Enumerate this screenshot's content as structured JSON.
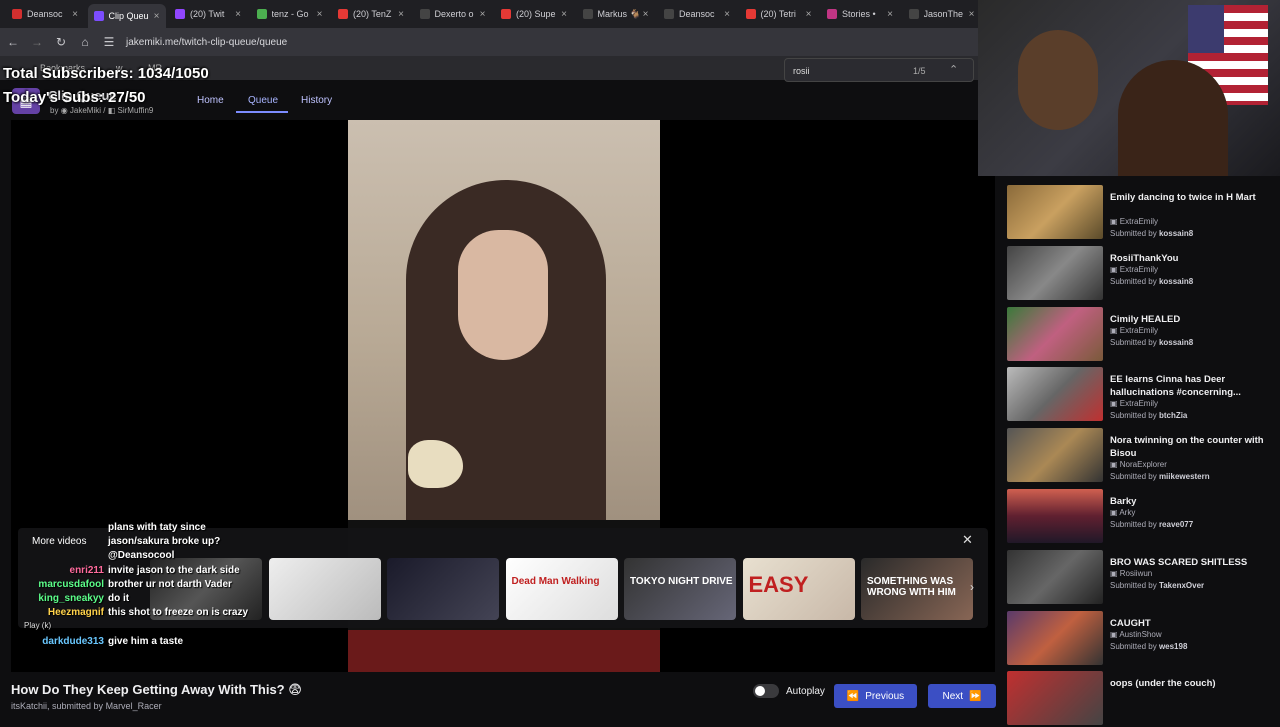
{
  "browser": {
    "tabs": [
      {
        "label": "Deansoc",
        "color": "#d32f2f"
      },
      {
        "label": "Clip Queu",
        "color": "#7c4dff",
        "active": true
      },
      {
        "label": "(20) Twit",
        "color": "#9146ff"
      },
      {
        "label": "tenz - Go",
        "color": "#4caf50"
      },
      {
        "label": "(20) TenZ",
        "color": "#e53935"
      },
      {
        "label": "Dexerto o",
        "color": "#444"
      },
      {
        "label": "(20) Supe",
        "color": "#e53935"
      },
      {
        "label": "Markus 🐐",
        "color": "#444"
      },
      {
        "label": "Deansoc",
        "color": "#444"
      },
      {
        "label": "(20) Tetri",
        "color": "#e53935"
      },
      {
        "label": "Stories •",
        "color": "#c13584"
      },
      {
        "label": "JasonThe",
        "color": "#444"
      }
    ],
    "url": "jakemiki.me/twitch-clip-queue/queue",
    "bookmarks": [
      "Bookmarks",
      "w",
      "MR"
    ],
    "find": {
      "query": "rosii",
      "count": "1/5"
    }
  },
  "overlay": {
    "total_subs": "Total Subscribers: 1034/1050",
    "todays_subs": "Today's Subs: 27/50"
  },
  "site": {
    "title": "Clip Queue",
    "by_prefix": "by",
    "author1": "JakeMiki",
    "author2": "SirMuffin9",
    "nav": {
      "home": "Home",
      "queue": "Queue",
      "history": "History"
    }
  },
  "more_videos": {
    "title": "More videos",
    "thumbs": [
      {
        "text": "",
        "bg": "linear-gradient(135deg,#222,#555,#222)"
      },
      {
        "text": "",
        "bg": "linear-gradient(135deg,#eee,#bbb)"
      },
      {
        "text": "",
        "bg": "linear-gradient(135deg,#1a1a2a,#445)"
      },
      {
        "text": "Dead Man Walking",
        "bg": "linear-gradient(135deg,#fff,#ddd)"
      },
      {
        "text": "TOKYO NIGHT DRIVE",
        "bg": "linear-gradient(135deg,#333,#667)"
      },
      {
        "text": "EASY",
        "bg": "linear-gradient(135deg,#e8e0d0,#c8b8a8)"
      },
      {
        "text": "SOMETHING WAS WRONG WITH HIM",
        "bg": "linear-gradient(135deg,#2a2a2a,#886655)"
      }
    ]
  },
  "chat": [
    {
      "user": "",
      "msg": "plans with taty since",
      "color": "#fff"
    },
    {
      "user": "",
      "msg": "jason/sakura broke up?",
      "color": "#fff"
    },
    {
      "user": "",
      "msg": "@Deansocool",
      "color": "#fff"
    },
    {
      "user": "enri211",
      "msg": "invite jason to the dark side",
      "color": "#ff6b9d"
    },
    {
      "user": "marcusdafool",
      "msg": "brother ur not darth Vader",
      "color": "#5cff8a"
    },
    {
      "user": "king_sneakyy",
      "msg": "do it",
      "color": "#5cff8a"
    },
    {
      "user": "Heezmagnif",
      "msg": "this shot to freeze on is crazy",
      "color": "#ffd24a"
    },
    {
      "user": "Play (k)",
      "msg": "",
      "color": "#ddd"
    },
    {
      "user": "darkdude313",
      "msg": "give him a taste",
      "color": "#6ac8ff"
    }
  ],
  "clip": {
    "title": "How Do They Keep Getting Away With This? 😨",
    "channel": "itsKatchii",
    "submitted_prefix": ", submitted by",
    "submitter": "Marvel_Racer"
  },
  "controls": {
    "autoplay": "Autoplay",
    "previous": "Previous",
    "next": "Next"
  },
  "queue": [
    {
      "title": "Emily dancing to twice in H Mart",
      "channel": "ExtraEmily",
      "submitter": "kossain8",
      "bg": "linear-gradient(135deg,#8a6a3a,#c9a060,#5a4a2a)"
    },
    {
      "title": "RosiiThankYou",
      "channel": "ExtraEmily",
      "submitter": "kossain8",
      "bg": "linear-gradient(135deg,#444,#888,#333)"
    },
    {
      "title": "Cimily HEALED",
      "channel": "ExtraEmily",
      "submitter": "kossain8",
      "bg": "linear-gradient(135deg,#3a7a3a,#c06080,#7a5a3a)"
    },
    {
      "title": "EE learns Cinna has Deer hallucinations #concerning...",
      "channel": "ExtraEmily",
      "submitter": "btchZia",
      "bg": "linear-gradient(135deg,#bbb,#666,#c03030)"
    },
    {
      "title": "Nora twinning on the counter with Bisou",
      "channel": "NoraExplorer",
      "submitter": "miikewestern",
      "bg": "linear-gradient(135deg,#555,#aa8855,#333)"
    },
    {
      "title": "Barky",
      "channel": "Arky",
      "submitter": "reave077",
      "bg": "linear-gradient(180deg,#d06050,#602030,#201828)"
    },
    {
      "title": "BRO WAS SCARED SHITLESS",
      "channel": "Rosiiwun",
      "submitter": "TakenxOver",
      "bg": "linear-gradient(135deg,#333,#666,#222)"
    },
    {
      "title": "CAUGHT",
      "channel": "AustinShow",
      "submitter": "wes198",
      "bg": "linear-gradient(135deg,#5a3a6a,#c06040,#333)"
    },
    {
      "title": "oops (under the couch)",
      "channel": "",
      "submitter": "",
      "bg": "linear-gradient(135deg,#c03030,#444)"
    }
  ],
  "labels": {
    "submitted_by": "Submitted by"
  }
}
